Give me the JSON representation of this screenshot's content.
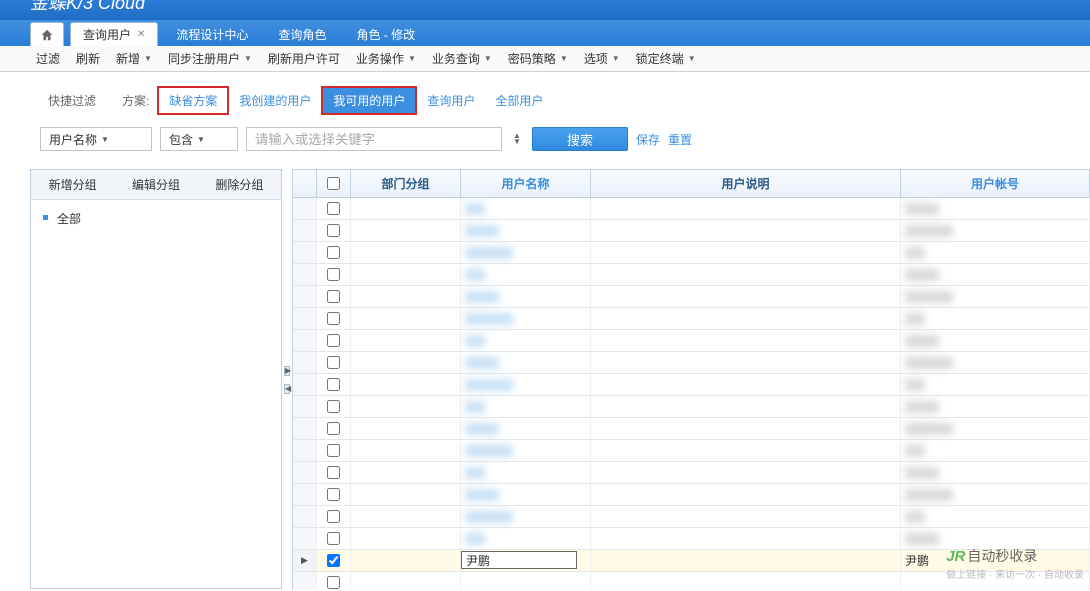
{
  "brand": "金蝶K/3 Cloud",
  "tabs": {
    "active": "查询用户",
    "items": [
      "查询用户",
      "流程设计中心",
      "查询角色",
      "角色 - 修改"
    ]
  },
  "toolbar": {
    "filter": "过滤",
    "refresh": "刷新",
    "new": "新增",
    "sync_users": "同步注册用户",
    "refresh_license": "刷新用户许可",
    "biz_ops": "业务操作",
    "biz_query": "业务查询",
    "pwd_policy": "密码策略",
    "options": "选项",
    "lock_terminal": "锁定终端"
  },
  "filter": {
    "quick_label": "快捷过滤",
    "scheme_label": "方案:",
    "schemes": {
      "default": "缺省方案",
      "created_by_me": "我创建的用户",
      "available": "我可用的用户",
      "query_user": "查询用户",
      "all_users": "全部用户"
    },
    "field_combo": "用户名称",
    "op_combo": "包含",
    "keyword_placeholder": "请输入或选择关键字",
    "search": "搜索",
    "save": "保存",
    "reset": "重置"
  },
  "sidebar": {
    "new_group": "新增分组",
    "edit_group": "编辑分组",
    "del_group": "删除分组",
    "tree_root": "全部"
  },
  "grid": {
    "cols": {
      "dept": "部门分组",
      "uname": "用户名称",
      "udesc": "用户说明",
      "uacct": "用户帐号"
    },
    "selected_row": {
      "uname": "尹鹏",
      "uacct": "尹鹏"
    }
  },
  "watermark": {
    "brand_prefix": "JR",
    "brand_text": "自动秒收录",
    "sub": "做上链接 · 来访一次 · 自动收录"
  }
}
